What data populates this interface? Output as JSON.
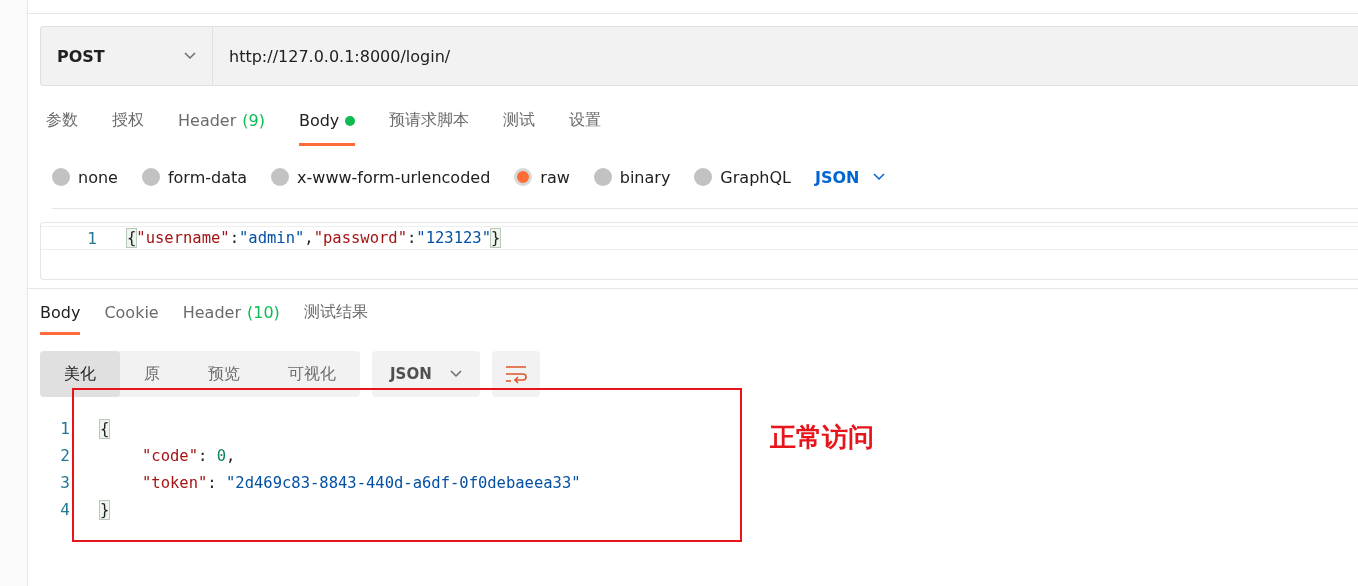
{
  "request": {
    "method": "POST",
    "url": "http://127.0.0.1:8000/login/"
  },
  "request_tabs": [
    {
      "label": "参数",
      "selected": false
    },
    {
      "label": "授权",
      "selected": false
    },
    {
      "label": "Header",
      "count": "(9)",
      "selected": false
    },
    {
      "label": "Body",
      "dot": true,
      "selected": true
    },
    {
      "label": "预请求脚本",
      "selected": false
    },
    {
      "label": "测试",
      "selected": false
    },
    {
      "label": "设置",
      "selected": false
    }
  ],
  "body_types": [
    {
      "label": "none",
      "selected": false
    },
    {
      "label": "form-data",
      "selected": false
    },
    {
      "label": "x-www-form-urlencoded",
      "selected": false
    },
    {
      "label": "raw",
      "selected": true
    },
    {
      "label": "binary",
      "selected": false
    },
    {
      "label": "GraphQL",
      "selected": false
    }
  ],
  "raw_format": "JSON",
  "request_body": [
    {
      "number": "1",
      "indented": false,
      "tokens": [
        {
          "kind": "brace",
          "text": "{"
        },
        {
          "kind": "key",
          "text": "\"username\""
        },
        {
          "kind": "punct",
          "text": ":"
        },
        {
          "kind": "string",
          "text": "\"admin\""
        },
        {
          "kind": "punct",
          "text": ","
        },
        {
          "kind": "key",
          "text": "\"password\""
        },
        {
          "kind": "punct",
          "text": ":"
        },
        {
          "kind": "string",
          "text": "\"123123\""
        },
        {
          "kind": "brace",
          "text": "}"
        }
      ]
    }
  ],
  "response_tabs": [
    {
      "label": "Body",
      "selected": true
    },
    {
      "label": "Cookie",
      "selected": false
    },
    {
      "label": "Header",
      "count": "(10)",
      "selected": false
    },
    {
      "label": "测试结果",
      "selected": false
    }
  ],
  "view_modes": [
    {
      "label": "美化",
      "selected": true
    },
    {
      "label": "原",
      "selected": false
    },
    {
      "label": "预览",
      "selected": false
    },
    {
      "label": "可视化",
      "selected": false
    }
  ],
  "response_format": "JSON",
  "response_body": [
    {
      "number": "1",
      "indented": false,
      "tokens": [
        {
          "kind": "brace",
          "text": "{"
        }
      ]
    },
    {
      "number": "2",
      "indented": true,
      "tokens": [
        {
          "kind": "key",
          "text": "\"code\""
        },
        {
          "kind": "punct",
          "text": ": "
        },
        {
          "kind": "number",
          "text": "0"
        },
        {
          "kind": "punct",
          "text": ","
        }
      ]
    },
    {
      "number": "3",
      "indented": true,
      "tokens": [
        {
          "kind": "key",
          "text": "\"token\""
        },
        {
          "kind": "punct",
          "text": ": "
        },
        {
          "kind": "string",
          "text": "\"2d469c83-8843-440d-a6df-0f0debaeea33\""
        }
      ]
    },
    {
      "number": "4",
      "indented": false,
      "tokens": [
        {
          "kind": "brace",
          "text": "}"
        }
      ]
    }
  ],
  "annotation": "正常访问"
}
